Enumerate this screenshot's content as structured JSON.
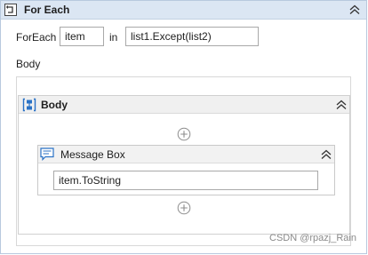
{
  "foreach": {
    "title": "For Each",
    "foreach_label": "ForEach",
    "item_variable": "item",
    "in_label": "in",
    "collection_expression": "list1.Except(list2)",
    "body_label": "Body"
  },
  "body_sequence": {
    "title": "Body"
  },
  "message_box": {
    "title": "Message Box",
    "text_expression": "item.ToString"
  },
  "watermark": "CSDN @rpazj_Rain",
  "icons": {
    "foreach": "foreach-loop-icon",
    "collapse": "chevron-double-up-icon",
    "sequence": "sequence-icon",
    "add": "add-activity-icon",
    "message": "message-box-icon"
  },
  "colors": {
    "header_bg": "#dbe6f3",
    "border": "#b8c9de",
    "icon_blue": "#2a72c6"
  }
}
